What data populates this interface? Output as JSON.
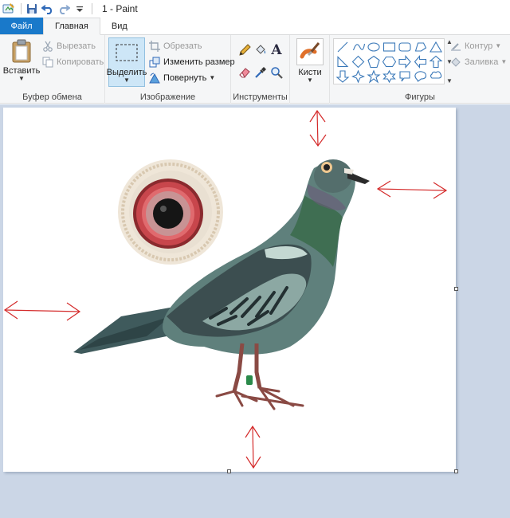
{
  "window": {
    "title": "1 - Paint"
  },
  "quick_access": {
    "icons": [
      "paint-app-icon",
      "save-icon",
      "undo-icon",
      "redo-icon",
      "customize-dropdown-icon"
    ]
  },
  "tabs": [
    {
      "label": "Файл",
      "kind": "file"
    },
    {
      "label": "Главная",
      "kind": "active"
    },
    {
      "label": "Вид",
      "kind": "normal"
    }
  ],
  "clipboard": {
    "group_label": "Буфер обмена",
    "paste_label": "Вставить",
    "cut_label": "Вырезать",
    "copy_label": "Копировать"
  },
  "image": {
    "group_label": "Изображение",
    "select_label": "Выделить",
    "crop_label": "Обрезать",
    "resize_label": "Изменить размер",
    "rotate_label": "Повернуть"
  },
  "tools": {
    "group_label": "Инструменты",
    "icons": [
      "pencil-icon",
      "fill-bucket-icon",
      "text-icon",
      "eraser-icon",
      "color-picker-icon",
      "magnifier-icon"
    ]
  },
  "brushes": {
    "label": "Кисти"
  },
  "shapes": {
    "group_label": "Фигуры",
    "outline_label": "Контур",
    "fill_label": "Заливка"
  },
  "colors": {
    "accent": "#1979ca",
    "ribbon_bg": "#f5f6f7",
    "workspace_bg": "#cbd6e6",
    "arrow_red": "#d42a2a",
    "shape_blue": "#3a78b8"
  }
}
